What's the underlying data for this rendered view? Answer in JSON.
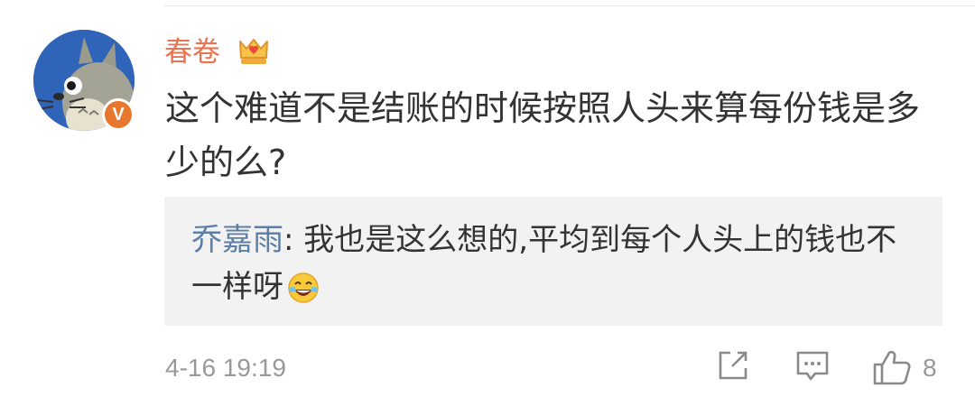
{
  "comment": {
    "username": "春卷",
    "verified_badge": "V",
    "text": "这个难道不是结账的时候按照人头来算每份钱是多少的么?",
    "timestamp": "4-16 19:19",
    "like_count": "8",
    "icons": [
      "totoro-avatar",
      "crown-icon",
      "share-icon",
      "comment-icon",
      "like-icon"
    ]
  },
  "reply": {
    "author": "乔嘉雨",
    "separator": ": ",
    "text": "我也是这么想的,平均到每个人头上的钱也不一样呀",
    "emoji": "laugh-cry-emoji"
  },
  "colors": {
    "username": "#eb7350",
    "reply_author": "#5d7ea6",
    "reply_background": "#f2f2f2",
    "meta_gray": "#999999",
    "avatar_blue": "#2f64b8",
    "badge_orange": "#e8772d"
  }
}
